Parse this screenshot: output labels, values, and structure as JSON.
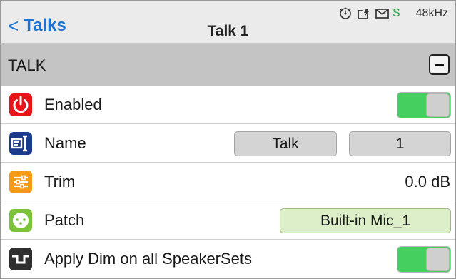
{
  "nav": {
    "back_label": "Talks",
    "title": "Talk 1",
    "status": {
      "sync_label": "S",
      "sample_rate": "48kHz"
    }
  },
  "section": {
    "title": "TALK"
  },
  "rows": [
    {
      "label": "Enabled",
      "icon": "power-icon",
      "icon_color": "#e8141a",
      "toggle_on": true
    },
    {
      "label": "Name",
      "icon": "name-tag-icon",
      "icon_color": "#1a3b8c",
      "button_1": "Talk",
      "button_2": "1"
    },
    {
      "label": "Trim",
      "icon": "sliders-icon",
      "icon_color": "#f59a16",
      "value": "0.0 dB"
    },
    {
      "label": "Patch",
      "icon": "connector-icon",
      "icon_color": "#7cc23a",
      "button": "Built-in Mic_1"
    },
    {
      "label": "Apply Dim on all SpeakerSets",
      "icon": "dim-pulse-icon",
      "icon_color": "#2f2f2f",
      "toggle_on": true
    }
  ],
  "colors": {
    "accent_blue": "#1c73d6",
    "toggle_on_green": "#44cf5e",
    "patch_button_green": "#dcefc8",
    "section_gray": "#c4c4c4",
    "sync_green": "#2ea043"
  }
}
